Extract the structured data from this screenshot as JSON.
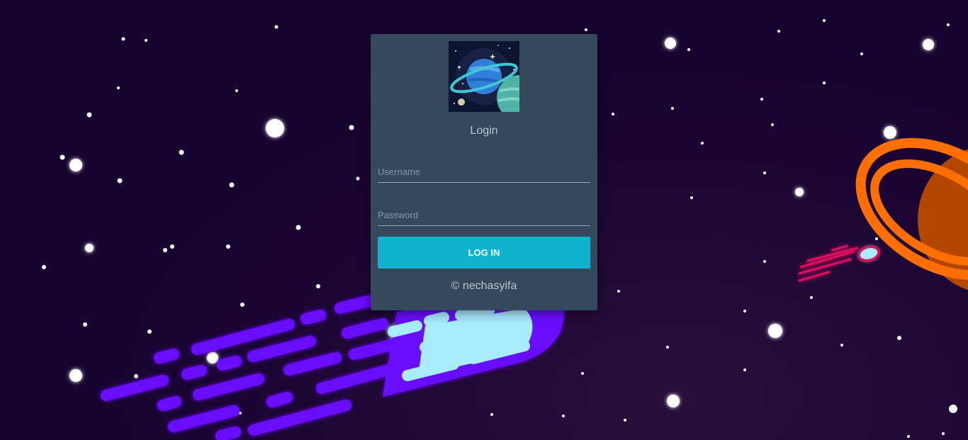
{
  "login": {
    "title": "Login",
    "username_placeholder": "Username",
    "password_placeholder": "Password",
    "button_label": "LOG IN",
    "footer": "© nechasyifa"
  },
  "colors": {
    "card": "#34495e",
    "button": "#10b4cf",
    "background": "#1a0533",
    "planet": "#ff6f00",
    "meteor_streaks": "#6a0dff",
    "comet": "#e0115f"
  },
  "icons": {
    "logo": "planet-logo-icon"
  }
}
